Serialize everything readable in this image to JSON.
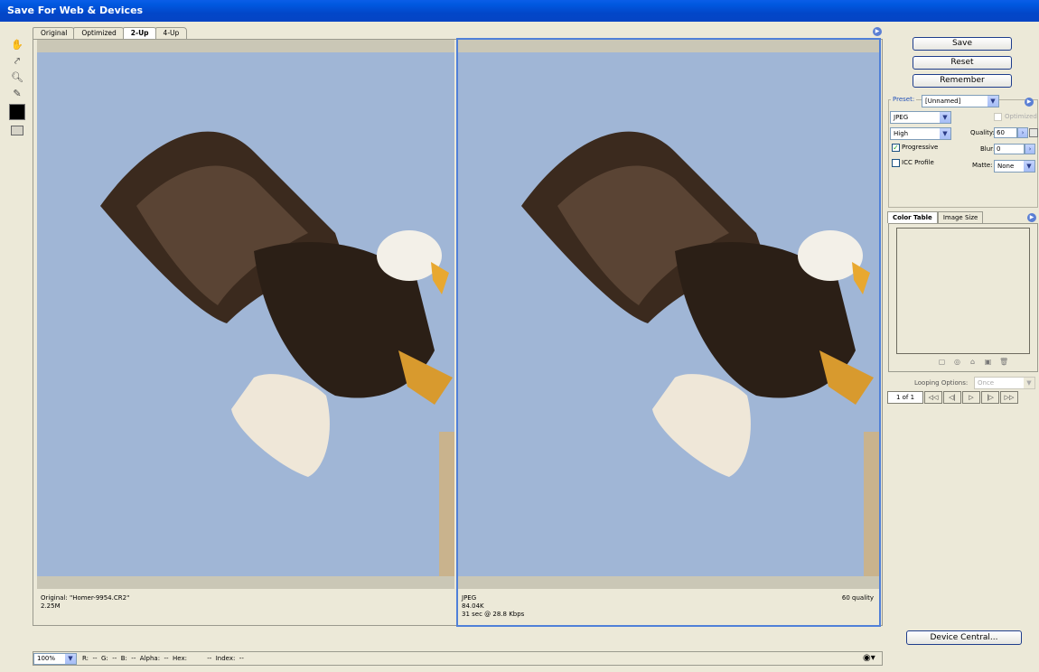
{
  "window": {
    "title": "Save For Web & Devices"
  },
  "tabs": [
    {
      "label": "Original"
    },
    {
      "label": "Optimized"
    },
    {
      "label": "2-Up"
    },
    {
      "label": "4-Up"
    }
  ],
  "panes": {
    "original": {
      "line1": "Original: \"Homer-9954.CR2\"",
      "line2": "2.25M"
    },
    "optimized": {
      "line1": "JPEG",
      "line2": "84.04K",
      "line3": "31 sec @ 28.8 Kbps",
      "quality": "60 quality"
    }
  },
  "buttons": {
    "save": "Save",
    "reset": "Reset",
    "remember": "Remember",
    "device_central": "Device Central..."
  },
  "settings": {
    "preset_label": "Preset:",
    "preset_value": "[Unnamed]",
    "format": "JPEG",
    "compression": "High",
    "optimized_label": "Optimized",
    "quality_label": "Quality:",
    "quality_value": "60",
    "progressive_label": "Progressive",
    "blur_label": "Blur:",
    "blur_value": "0",
    "icc_label": "ICC Profile",
    "matte_label": "Matte:",
    "matte_value": "None"
  },
  "color_table": {
    "tab_color": "Color Table",
    "tab_size": "Image Size"
  },
  "animation": {
    "looping_label": "Looping Options:",
    "looping_value": "Once",
    "frame": "1 of 1"
  },
  "status": {
    "zoom": "100%",
    "readout": "R:  --  G:  --  B:  --  Alpha:  --  Hex:          --  Index:  --"
  },
  "icons": [
    "hand-icon",
    "slice-select-icon",
    "zoom-icon",
    "eyedropper-icon",
    "color-swatch-icon",
    "toggle-slices-icon",
    "menu-arrow-icon",
    "browser-preview-icon"
  ],
  "colors": {
    "titlebar": "#0054e3",
    "sky": "#a0b6d6",
    "selection": "#5080d8"
  }
}
